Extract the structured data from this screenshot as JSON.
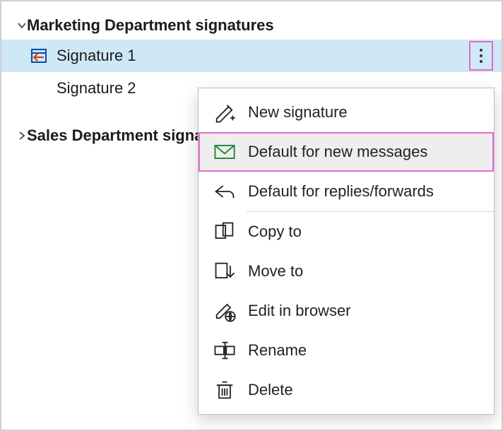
{
  "tree": {
    "groups": [
      {
        "id": "marketing",
        "label": "Marketing Department signatures",
        "expanded": true,
        "items": [
          {
            "id": "sig1",
            "label": "Signature 1",
            "selected": true,
            "hasExportIcon": true
          },
          {
            "id": "sig2",
            "label": "Signature 2",
            "selected": false,
            "hasExportIcon": false
          }
        ]
      },
      {
        "id": "sales",
        "label": "Sales Department signatures",
        "expanded": false,
        "items": []
      }
    ]
  },
  "context_menu": {
    "target": "sig1",
    "items": [
      {
        "id": "new",
        "label": "New signature",
        "icon": "pen-plus-icon"
      },
      {
        "id": "defnew",
        "label": "Default for new messages",
        "icon": "envelope-icon",
        "highlighted": true,
        "iconGreen": true
      },
      {
        "id": "defrep",
        "label": "Default for replies/forwards",
        "icon": "reply-arrow-icon",
        "dividerAfter": true
      },
      {
        "id": "copy",
        "label": "Copy to",
        "icon": "copy-to-icon"
      },
      {
        "id": "move",
        "label": "Move to",
        "icon": "move-down-icon"
      },
      {
        "id": "editb",
        "label": "Edit in browser",
        "icon": "pen-globe-icon"
      },
      {
        "id": "rename",
        "label": "Rename",
        "icon": "rename-icon"
      },
      {
        "id": "delete",
        "label": "Delete",
        "icon": "trash-icon"
      }
    ]
  },
  "icons": {
    "more": "more-vertical-icon"
  }
}
